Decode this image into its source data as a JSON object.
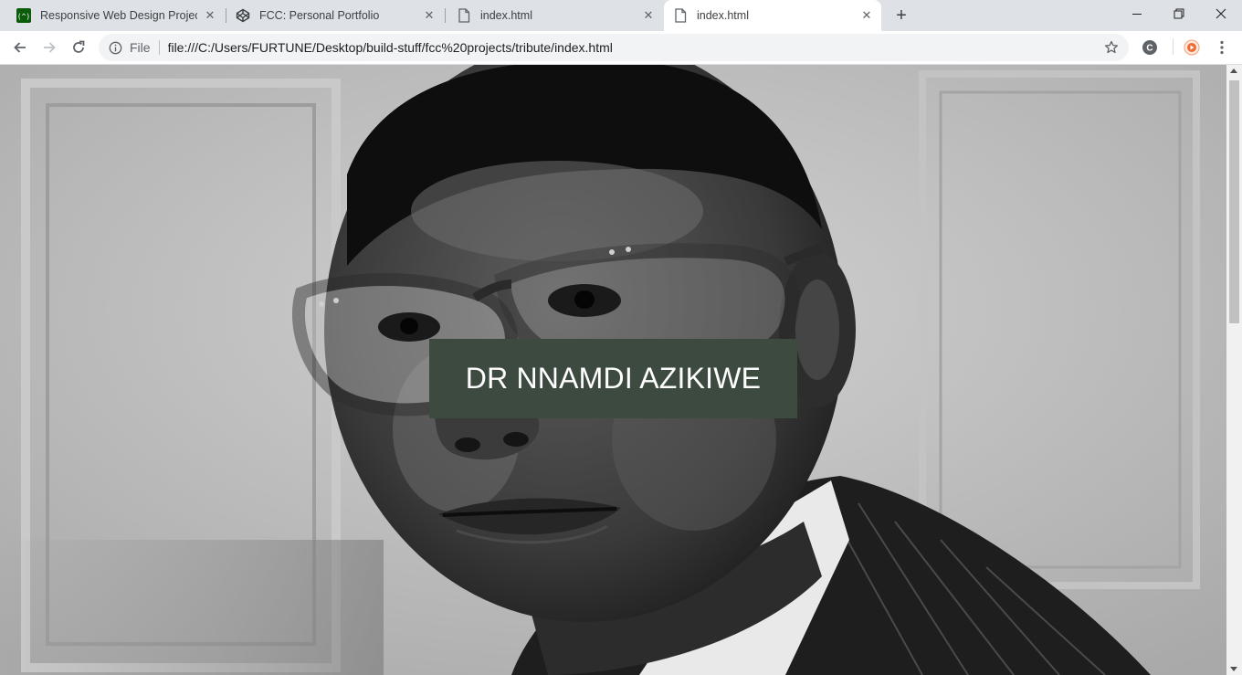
{
  "browser": {
    "tabs": [
      {
        "title": "Responsive Web Design Projects",
        "icon": "freecodecamp-icon",
        "active": false
      },
      {
        "title": "FCC: Personal Portfolio",
        "icon": "codepen-icon",
        "active": false
      },
      {
        "title": "index.html",
        "icon": "file-icon",
        "active": false
      },
      {
        "title": "index.html",
        "icon": "file-icon",
        "active": true
      }
    ],
    "address_bar": {
      "scheme_label": "File",
      "url": "file:///C:/Users/FURTUNE/Desktop/build-stuff/fcc%20projects/tribute/index.html"
    }
  },
  "page": {
    "title": "DR NNAMDI AZIKIWE",
    "title_bg": "#3c4a40",
    "title_color": "#ffffff"
  }
}
